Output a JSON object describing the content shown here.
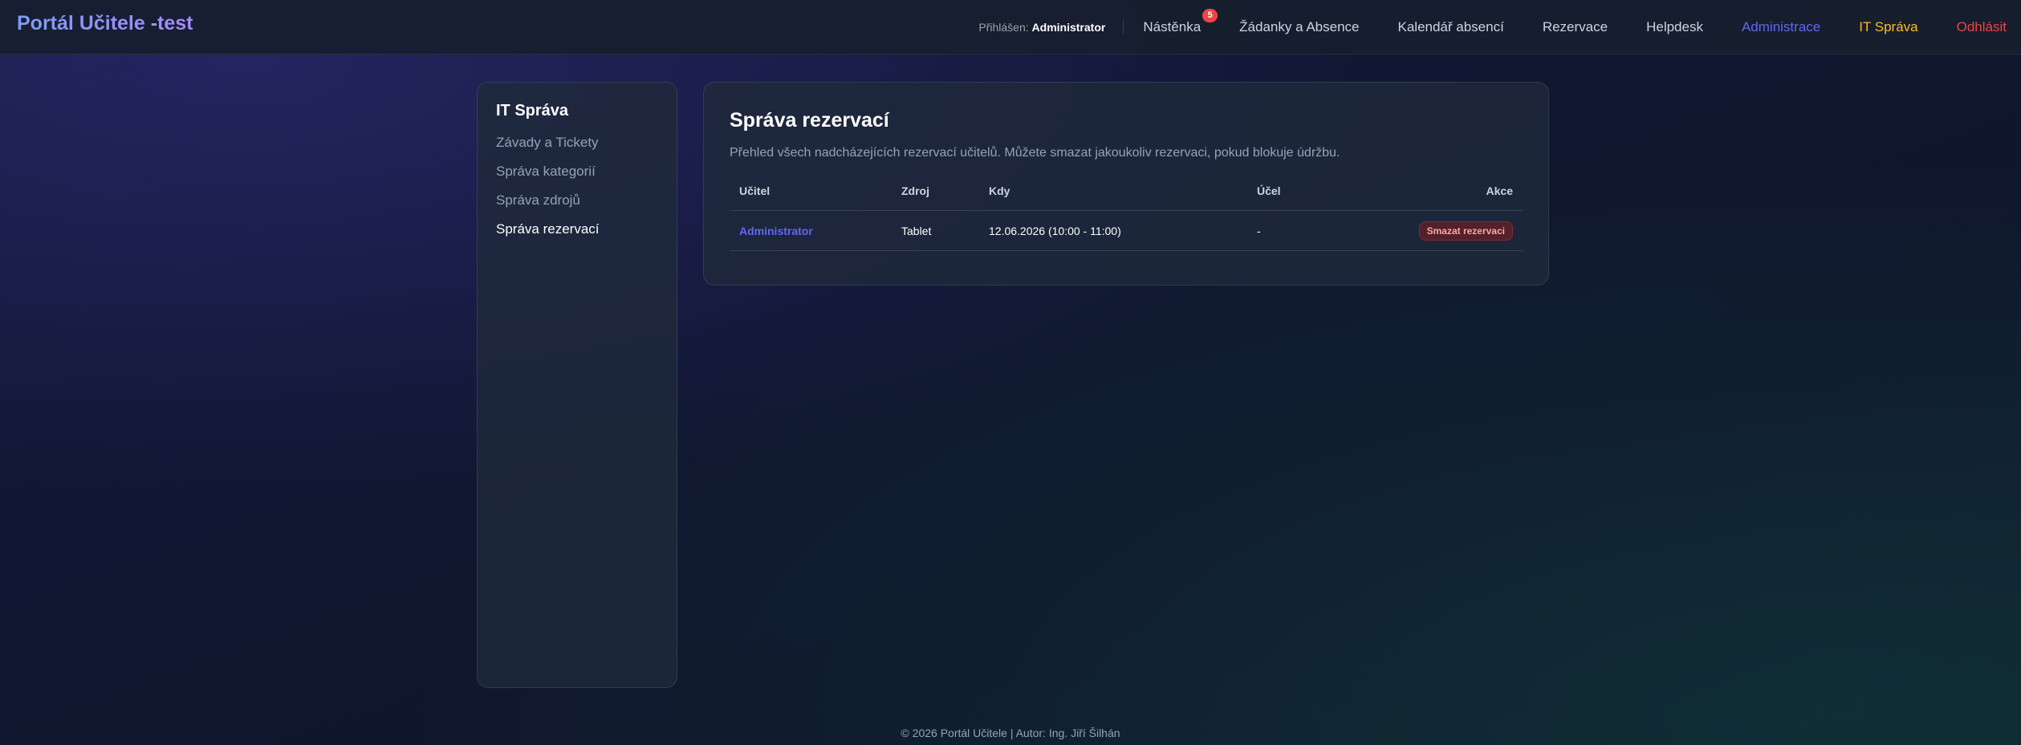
{
  "header": {
    "brand": "Portál Učitele -test",
    "logged_in_label": "Přihlášen:",
    "logged_in_user": "Administrator",
    "nav": [
      {
        "label": "Nástěnka",
        "badge": "5"
      },
      {
        "label": "Žádanky a Absence"
      },
      {
        "label": "Kalendář absencí"
      },
      {
        "label": "Rezervace"
      },
      {
        "label": "Helpdesk"
      },
      {
        "label": "Administrace",
        "color": "#6366f1"
      },
      {
        "label": "IT Správa",
        "color": "#fbbf24"
      },
      {
        "label": "Odhlásit",
        "color": "#ef4444"
      }
    ]
  },
  "sidebar": {
    "title": "IT Správa",
    "items": [
      {
        "label": "Závady a Tickety"
      },
      {
        "label": "Správa kategorií"
      },
      {
        "label": "Správa zdrojů"
      },
      {
        "label": "Správa rezervací",
        "active": true
      }
    ]
  },
  "main": {
    "title": "Správa rezervací",
    "description": "Přehled všech nadcházejících rezervací učitelů. Můžete smazat jakoukoliv rezervaci, pokud blokuje údržbu.",
    "table": {
      "columns": [
        "Učitel",
        "Zdroj",
        "Kdy",
        "Účel",
        "Akce"
      ],
      "rows": [
        {
          "teacher": "Administrator",
          "resource": "Tablet",
          "when": "12.06.2026 (10:00 - 11:00)",
          "purpose": "-",
          "action": "Smazat rezervaci"
        }
      ]
    }
  },
  "footer": {
    "text": "© 2026 Portál Učitele | Autor: Ing. Jiří Šilhán"
  }
}
